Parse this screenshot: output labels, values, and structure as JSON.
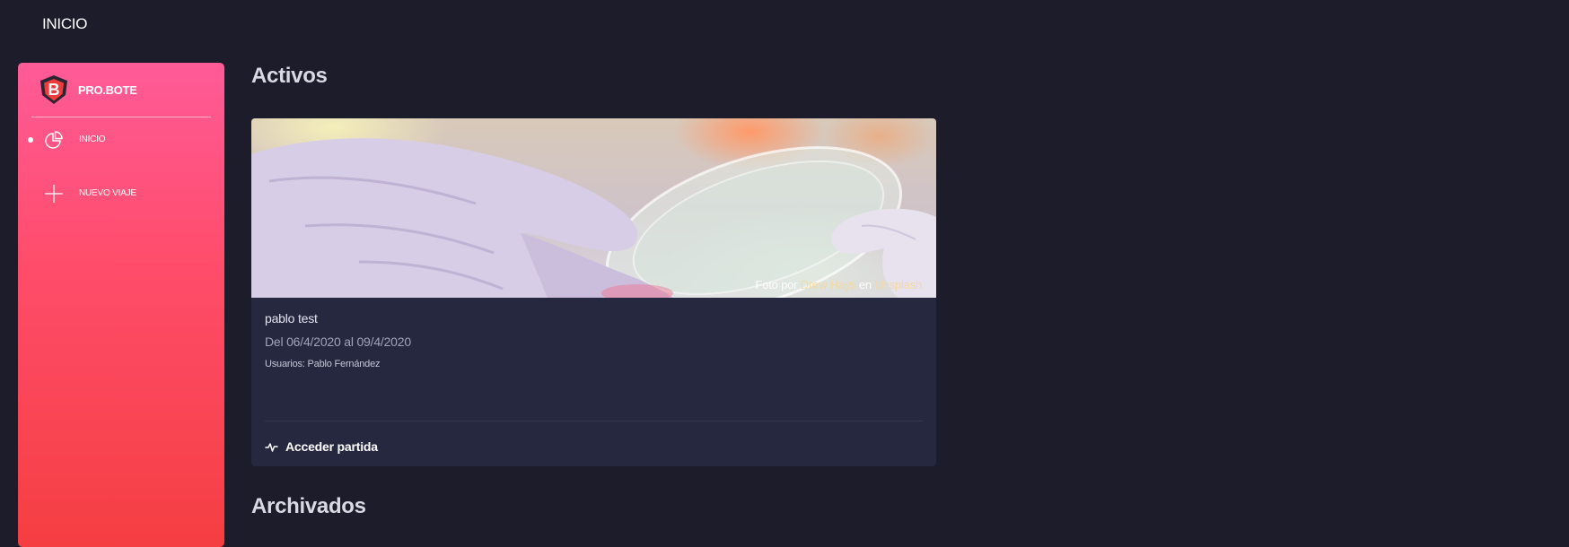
{
  "header": {
    "title": "INICIO"
  },
  "sidebar": {
    "brand": {
      "name": "PRO.BOTE",
      "logo_letter": "B",
      "logo_icon": "shield-b-logo"
    },
    "items": [
      {
        "label": "INICIO",
        "icon": "pie-chart-icon",
        "active": true
      },
      {
        "label": "NUEVO VIAJE",
        "icon": "plus-icon",
        "active": false
      }
    ]
  },
  "sections": {
    "active_title": "Activos",
    "archived_title": "Archivados"
  },
  "card": {
    "image_credit": {
      "prefix": "Foto por",
      "author": "Drew Hays",
      "connector": "en",
      "source": "Unsplash"
    },
    "title": "pablo test",
    "dates": "Del 06/4/2020 al 09/4/2020",
    "users": "Usuarios: Pablo Fernández",
    "action_label": "Acceder partida",
    "action_icon": "activity-pulse-icon"
  },
  "colors": {
    "background": "#1d1c2b",
    "card": "#262840",
    "sidebar_gradient_top": "#ff5b98",
    "sidebar_gradient_bottom": "#f53e42",
    "credit_link": "#f3d9a2"
  }
}
